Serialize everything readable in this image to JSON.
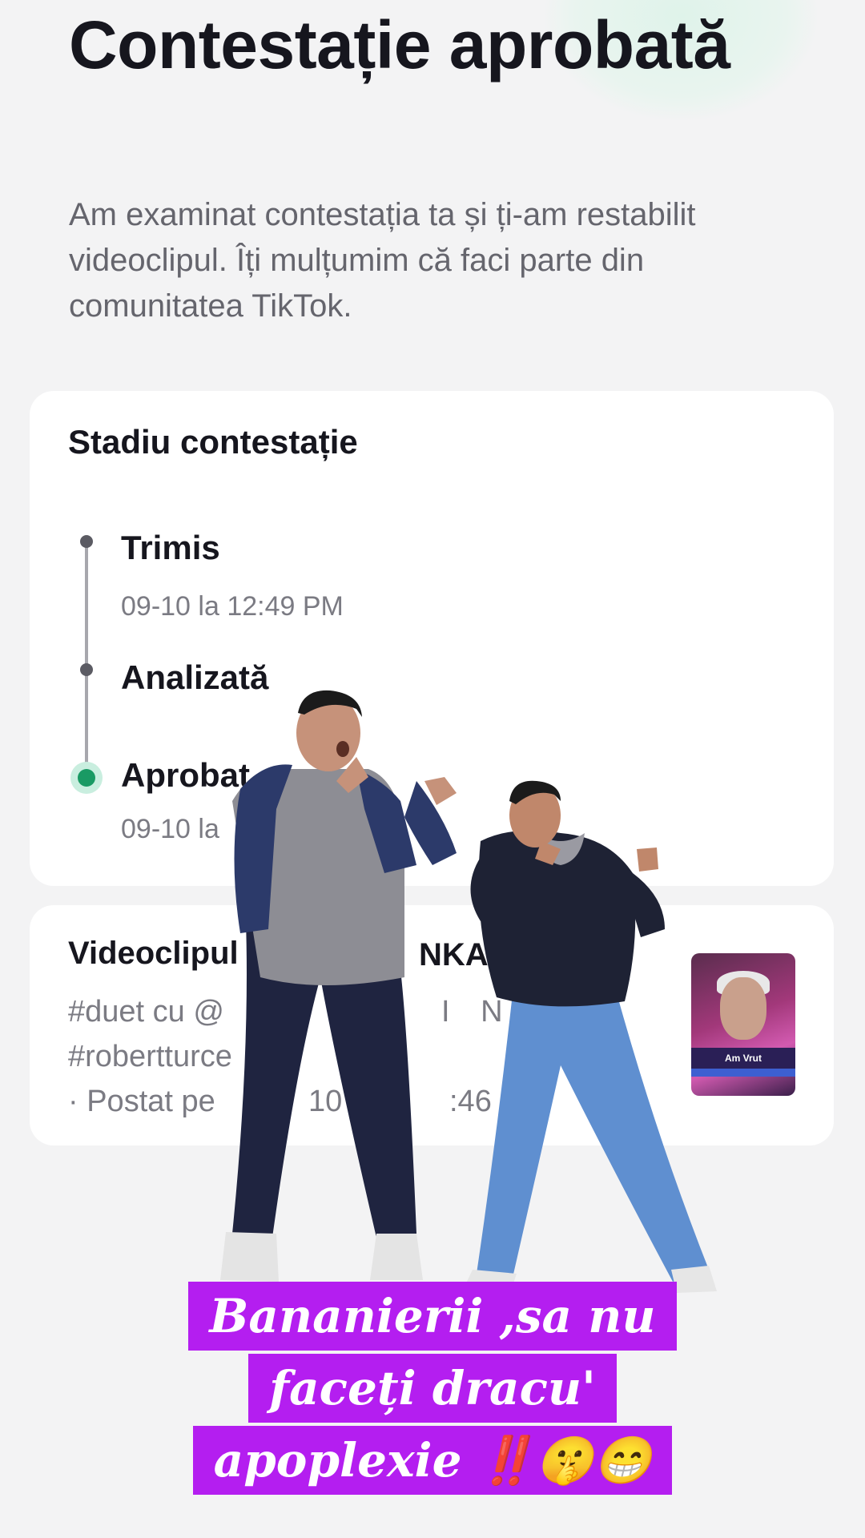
{
  "header": {
    "title": "Contestație aprobată",
    "subtitle": "Am examinat contestația ta și ți-am restabilit videoclipul. Îți mulțumim că faci parte din comunitatea TikTok."
  },
  "status_card": {
    "title": "Stadiu contestație",
    "steps": [
      {
        "label": "Trimis",
        "time": "09-10 la 12:49 PM"
      },
      {
        "label": "Analizată",
        "time": ""
      },
      {
        "label": "Aprobat",
        "time": "09-10 la"
      }
    ]
  },
  "video_card": {
    "title": "Videoclipul",
    "title_suffix": "NKA⚜️",
    "line1": "#duet cu @",
    "line1_suffix": "I N",
    "line2": "#robertturce",
    "line3": "· Postat pe",
    "line3_suffix": "10 la",
    "line3_time": ":46",
    "thumbnail_caption": "Am Vrut"
  },
  "caption": {
    "line1": "Bananierii ,sa nu",
    "line2": "faceți dracu'",
    "line3": "apoplexie ‼️🤫😁"
  },
  "colors": {
    "background": "#f3f3f4",
    "card": "#ffffff",
    "accent_green": "#1a9a64",
    "caption_bg": "#b41ef0"
  }
}
